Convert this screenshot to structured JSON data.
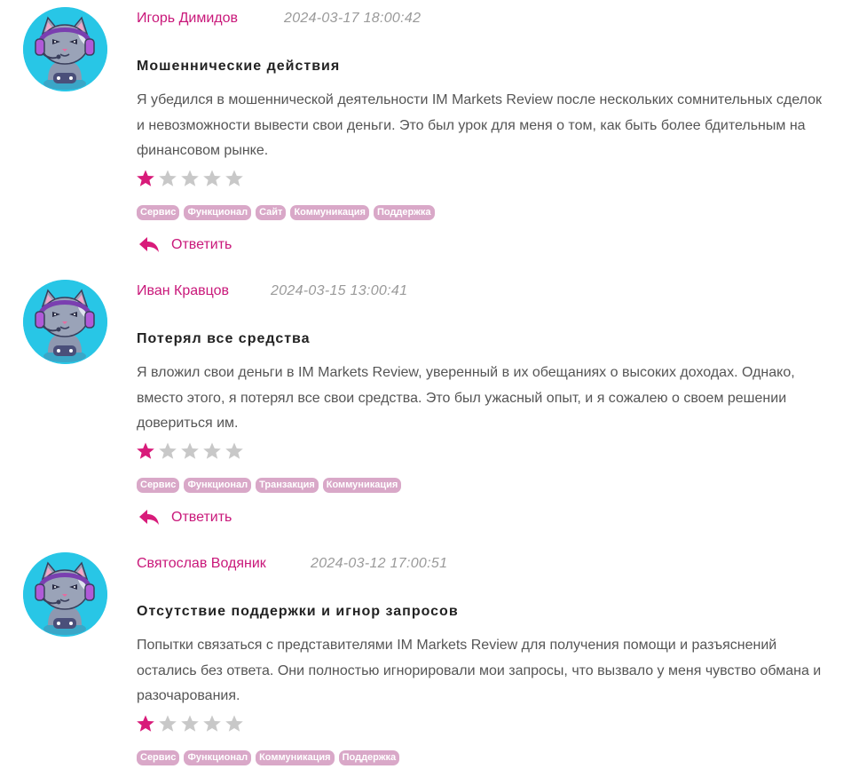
{
  "colors": {
    "accent": "#c9187a",
    "tag_bg": "#d9a8c8",
    "star_filled": "#d81b7a",
    "star_empty": "#c8c8c8",
    "avatar_bg": "#28c6e6"
  },
  "reviews": [
    {
      "author": "Игорь Димидов",
      "date": "2024-03-17 18:00:42",
      "title": "Мошеннические действия",
      "text": "Я убедился в мошеннической деятельности IM Markets Review после нескольких сомнительных сделок и невозможности вывести свои деньги. Это был урок для меня о том, как быть более бдительным на финансовом рынке.",
      "rating": 1,
      "rating_max": 5,
      "tags": [
        "Сервис",
        "Функционал",
        "Сайт",
        "Коммуникация",
        "Поддержка"
      ],
      "reply_label": "Ответить"
    },
    {
      "author": "Иван Кравцов",
      "date": "2024-03-15 13:00:41",
      "title": "Потерял все средства",
      "text": "Я вложил свои деньги в IM Markets Review, уверенный в их обещаниях о высоких доходах. Однако, вместо этого, я потерял все свои средства. Это был ужасный опыт, и я сожалею о своем решении довериться им.",
      "rating": 1,
      "rating_max": 5,
      "tags": [
        "Сервис",
        "Функционал",
        "Транзакция",
        "Коммуникация"
      ],
      "reply_label": "Ответить"
    },
    {
      "author": "Святослав Водяник",
      "date": "2024-03-12 17:00:51",
      "title": "Отсутствие поддержки и игнор запросов",
      "text": "Попытки связаться с представителями IM Markets Review для получения помощи и разъяснений остались без ответа. Они полностью игнорировали мои запросы, что вызвало у меня чувство обмана и разочарования.",
      "rating": 1,
      "rating_max": 5,
      "tags": [
        "Сервис",
        "Функционал",
        "Коммуникация",
        "Поддержка"
      ]
    }
  ]
}
